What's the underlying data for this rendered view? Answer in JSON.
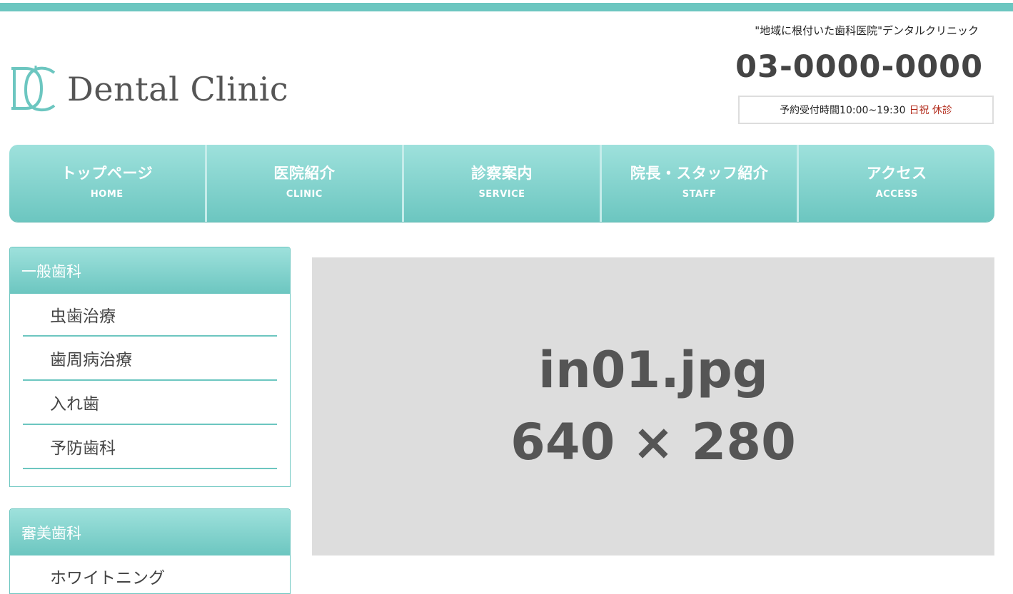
{
  "colors": {
    "accent": "#6cc6c0",
    "accent_light": "#9ee1dc",
    "closed": "#b22a1a",
    "placeholder_bg": "#dddddd"
  },
  "header": {
    "logo_text": "Dental Clinic",
    "logo_mark_letters": "DC",
    "tagline": "\"地域に根付いた歯科医院\"デンタルクリニック",
    "phone": "03-0000-0000",
    "hours_label": "予約受付時間10:00~19:30",
    "closed_label": "日祝 休診"
  },
  "nav": [
    {
      "label": "トップページ",
      "sub": "HOME"
    },
    {
      "label": "医院紹介",
      "sub": "CLINIC"
    },
    {
      "label": "診察案内",
      "sub": "SERVICE"
    },
    {
      "label": "院長・スタッフ紹介",
      "sub": "STAFF"
    },
    {
      "label": "アクセス",
      "sub": "ACCESS"
    }
  ],
  "sidebar": {
    "general": {
      "title": "一般歯科",
      "items": [
        "虫歯治療",
        "歯周病治療",
        "入れ歯",
        "予防歯科"
      ]
    },
    "cosmetic": {
      "title": "審美歯科",
      "items": [
        "ホワイトニング"
      ]
    }
  },
  "main": {
    "image_name": "in01.jpg",
    "image_size": "640 × 280"
  }
}
